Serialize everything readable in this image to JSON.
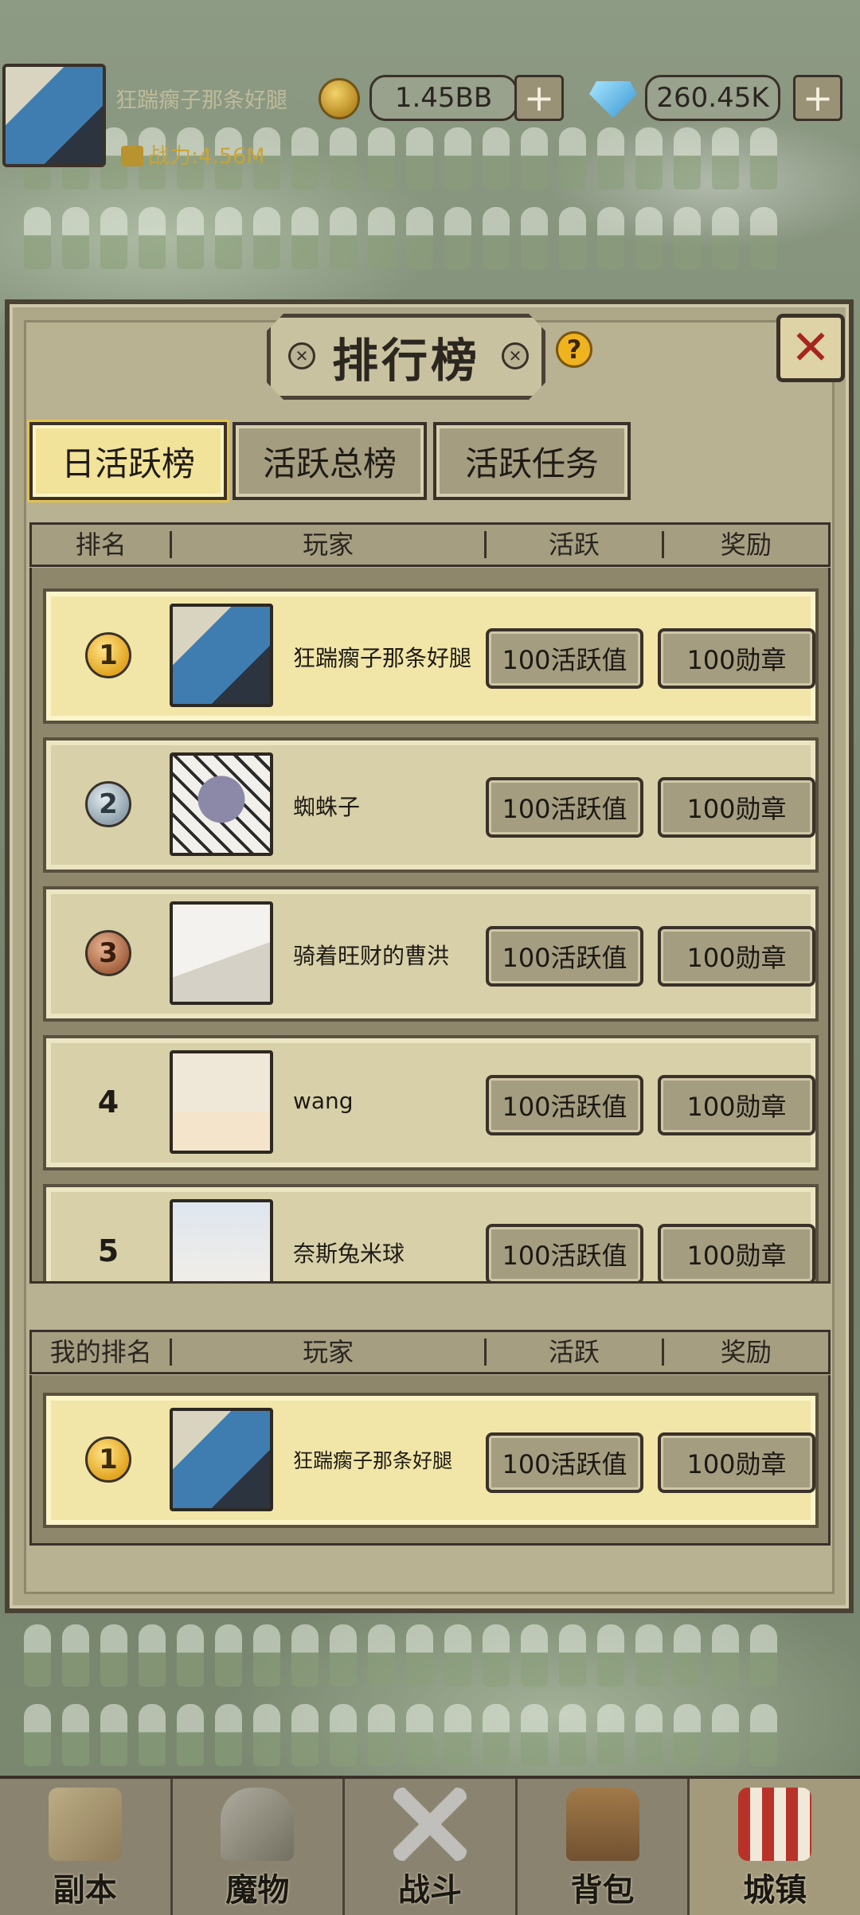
{
  "top_bar": {
    "player_name": "狂踹瘸子那条好腿",
    "power": "战力:4.56M",
    "gold": "1.45BB",
    "gems": "260.45K",
    "plus": "+"
  },
  "panel": {
    "title": "排行榜",
    "help": "?",
    "close": "✕"
  },
  "tabs": [
    {
      "label": "日活跃榜",
      "active": true
    },
    {
      "label": "活跃总榜",
      "active": false
    },
    {
      "label": "活跃任务",
      "active": false
    }
  ],
  "table_header": [
    "排名",
    "玩家",
    "活跃",
    "奖励"
  ],
  "rows": [
    {
      "rank": "1",
      "name": "狂踹瘸子那条好腿",
      "activity": "100活跃值",
      "reward": "100勋章",
      "avatar": "dragon"
    },
    {
      "rank": "2",
      "name": "蜘蛛子",
      "activity": "100活跃值",
      "reward": "100勋章",
      "avatar": "spider"
    },
    {
      "rank": "3",
      "name": "骑着旺财的曹洪",
      "activity": "100活跃值",
      "reward": "100勋章",
      "avatar": "wolf"
    },
    {
      "rank": "4",
      "name": "wang",
      "activity": "100活跃值",
      "reward": "100勋章",
      "avatar": "girl"
    },
    {
      "rank": "5",
      "name": "奈斯兔米球",
      "activity": "100活跃值",
      "reward": "100勋章",
      "avatar": "white"
    }
  ],
  "my_header": [
    "我的排名",
    "玩家",
    "活跃",
    "奖励"
  ],
  "my_row": {
    "rank": "1",
    "name": "狂踹瘸子那条好腿",
    "activity": "100活跃值",
    "reward": "100勋章",
    "avatar": "dragon"
  },
  "bottom_nav": [
    {
      "label": "副本",
      "icon": "map-icon"
    },
    {
      "label": "魔物",
      "icon": "monster-helmet-icon"
    },
    {
      "label": "战斗",
      "icon": "crossed-swords-icon"
    },
    {
      "label": "背包",
      "icon": "backpack-icon"
    },
    {
      "label": "城镇",
      "icon": "town-shop-icon",
      "active": true
    }
  ],
  "colors": {
    "panel_bg": "#aea788",
    "active_tab": "#f2e39a",
    "close_x": "#a6261e",
    "power_text": "#c8a43a"
  }
}
